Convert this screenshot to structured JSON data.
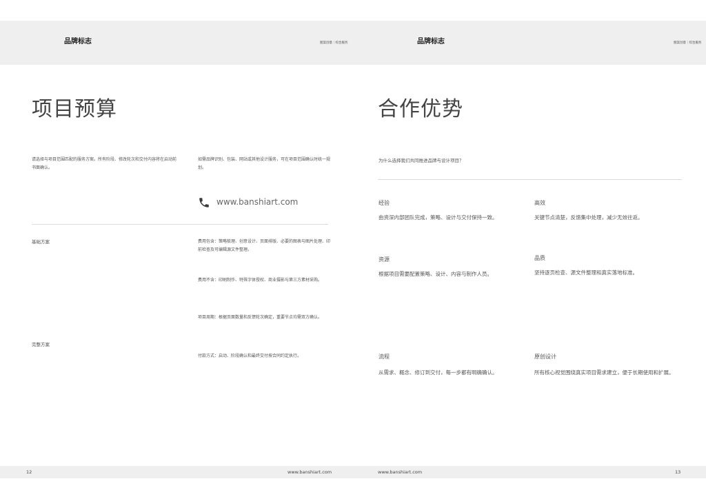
{
  "left_page": {
    "header": {
      "brand": "品牌标志",
      "right": "图案创意｜综合服务"
    },
    "title": "项目预算",
    "intro_left": "请选择与项目范围匹配的服务方案。所有阶段、修改轮次和交付内容将在启动前书面确认。",
    "intro_right": "如需品牌识别、包装、网站或其他设计服务，可在项目范围确认时统一规划。",
    "contact_url": "www.banshiart.com",
    "plans": [
      {
        "label": "基础方案"
      },
      {
        "label": "完整方案"
      }
    ],
    "terms": [
      "费用包含：策略梳理、创意设计、页面排版、必要的图表与图片处理、印前检查及可编辑源文件整理。",
      "费用不含：印刷制作、特殊字体授权、商业摄影与第三方素材采购。",
      "项目周期：根据页面数量和反馈轮次确定，重要节点均需双方确认。",
      "付款方式：启动、阶段确认和最终交付按合同约定执行。"
    ],
    "footer": {
      "page_number": "12",
      "url": "www.banshiart.com"
    }
  },
  "right_page": {
    "header": {
      "brand": "品牌标志",
      "right": "图案创意｜综合服务"
    },
    "title": "合作优势",
    "question": "为什么选择我们共同推进品牌与设计项目？",
    "features": [
      {
        "title": "经验",
        "desc": "由资深内部团队完成，策略、设计与交付保持一致。"
      },
      {
        "title": "高效",
        "desc": "关键节点清楚，反馈集中处理，减少无效往返。"
      },
      {
        "title": "资源",
        "desc": "根据项目需要配置策略、设计、内容与制作人员。"
      },
      {
        "title": "品质",
        "desc": "坚持逐页检查、源文件整理和真实落地标准。"
      },
      {
        "title": "流程",
        "desc": "从需求、概念、修订到交付，每一步都有明确确认。"
      },
      {
        "title": "原创设计",
        "desc": "所有核心视觉围绕真实项目需求建立，便于长期使用和扩展。"
      }
    ],
    "footer": {
      "page_number": "13",
      "url": "www.banshiart.com"
    }
  },
  "icons": {
    "contact": "phone-icon"
  }
}
